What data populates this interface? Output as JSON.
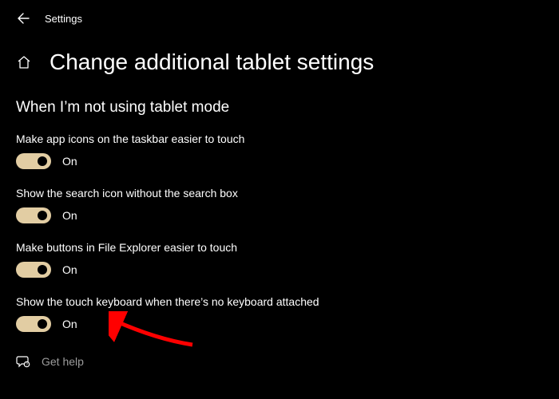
{
  "top": {
    "title": "Settings"
  },
  "page": {
    "title": "Change additional tablet settings"
  },
  "section": {
    "heading": "When I’m not using tablet mode"
  },
  "settings": [
    {
      "label": "Make app icons on the taskbar easier to touch",
      "state": "On"
    },
    {
      "label": "Show the search icon without the search box",
      "state": "On"
    },
    {
      "label": "Make buttons in File Explorer easier to touch",
      "state": "On"
    },
    {
      "label": "Show the touch keyboard when there’s no keyboard attached",
      "state": "On"
    }
  ],
  "help": {
    "label": "Get help"
  }
}
